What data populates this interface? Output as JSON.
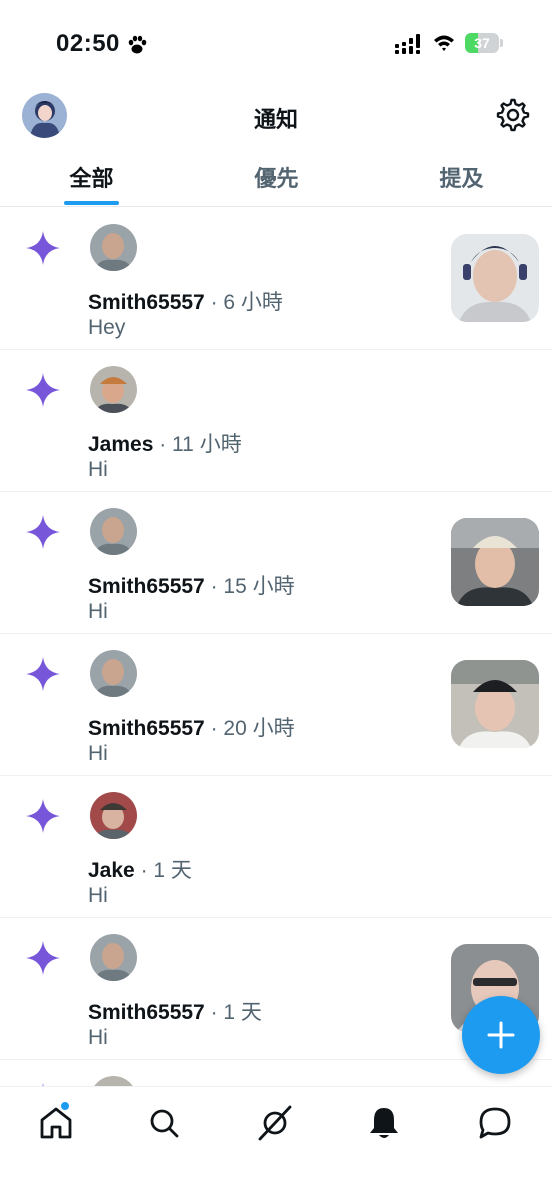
{
  "status_bar": {
    "time": "02:50",
    "battery": "37",
    "battery_level": 0.37
  },
  "header": {
    "title": "通知"
  },
  "tabs": [
    {
      "label": "全部",
      "active": true
    },
    {
      "label": "優先",
      "active": false
    },
    {
      "label": "提及",
      "active": false
    }
  ],
  "notifications": [
    {
      "user": "Smith65557",
      "time": "· 6 小時",
      "message": "Hey",
      "has_thumbnail": true
    },
    {
      "user": "James",
      "time": "· 11 小時",
      "message": "Hi",
      "has_thumbnail": false
    },
    {
      "user": "Smith65557",
      "time": "· 15 小時",
      "message": "Hi",
      "has_thumbnail": true
    },
    {
      "user": "Smith65557",
      "time": "· 20 小時",
      "message": "Hi",
      "has_thumbnail": true
    },
    {
      "user": "Jake",
      "time": "· 1 天",
      "message": "Hi",
      "has_thumbnail": false
    },
    {
      "user": "Smith65557",
      "time": "· 1 天",
      "message": "Hi",
      "has_thumbnail": true
    }
  ],
  "colors": {
    "accent": "#1d9bf0",
    "sparkle": "#7856d9",
    "battery_green": "#4cd964",
    "secondary_text": "#536471"
  },
  "icons": {
    "status": [
      "paw-icon",
      "signal-icon",
      "wifi-icon",
      "battery-icon"
    ],
    "header": [
      "avatar",
      "gear-icon"
    ],
    "notification": "sparkle-icon",
    "fab": "plus-icon",
    "bottom_nav": [
      "home-icon",
      "search-icon",
      "grok-icon",
      "bell-icon",
      "message-icon"
    ]
  }
}
